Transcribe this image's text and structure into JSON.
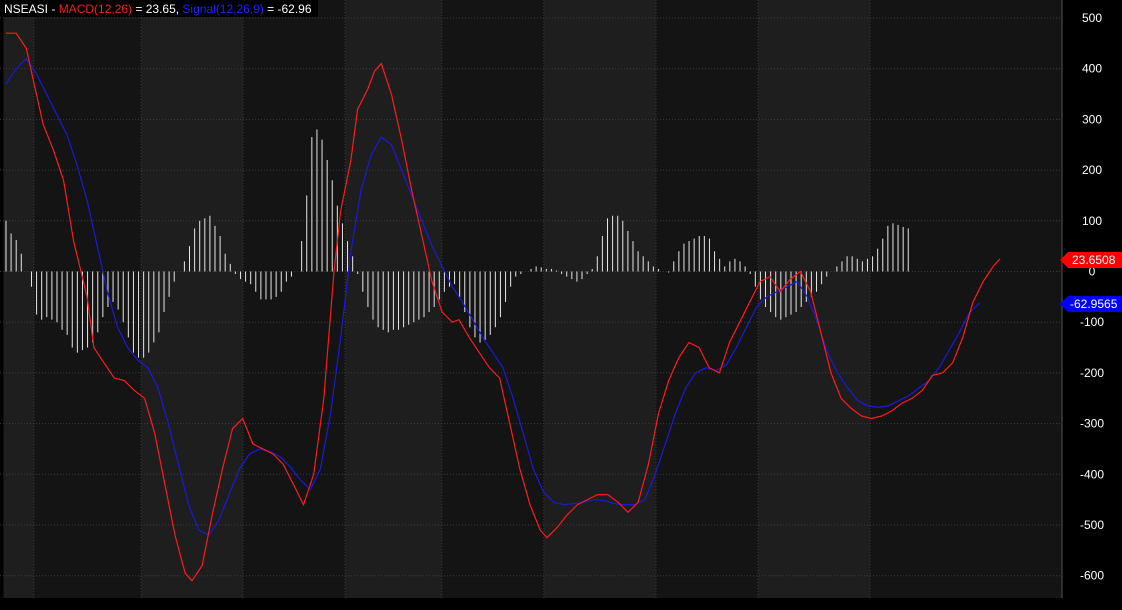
{
  "legend": {
    "symbol": "NSEASI",
    "separator": " - ",
    "macd_label": "MACD(12,26)",
    "macd_value_text": " = 23.65, ",
    "signal_label": "Signal(12,26,9)",
    "signal_value_text": " = -62.96"
  },
  "badges": {
    "macd": "23.6508",
    "signal": "-62.9565"
  },
  "colors": {
    "background": "#000000",
    "panel_dark": "#141414",
    "panel_light": "#1e1e1e",
    "grid": "#3a3a3a",
    "macd": "#ff1a1a",
    "signal": "#1a1adc",
    "histogram": "#e6e6e6",
    "axis_text": "#ffffff",
    "macd_badge": "#ff0000",
    "signal_badge": "#0000ff"
  },
  "chart_data": {
    "type": "line",
    "title": "",
    "xlabel": "",
    "ylabel": "",
    "ylim": [
      -630,
      530
    ],
    "y_ticks": [
      500,
      400,
      300,
      200,
      100,
      0,
      -100,
      -200,
      -300,
      -400,
      -500,
      -600
    ],
    "grid": true,
    "n_bars": 196,
    "bands": [
      {
        "from": 0,
        "to": 6,
        "shade": "light"
      },
      {
        "from": 6,
        "to": 27,
        "shade": "dark"
      },
      {
        "from": 27,
        "to": 47,
        "shade": "light"
      },
      {
        "from": 47,
        "to": 67,
        "shade": "dark"
      },
      {
        "from": 67,
        "to": 86,
        "shade": "light"
      },
      {
        "from": 86,
        "to": 106,
        "shade": "dark"
      },
      {
        "from": 106,
        "to": 128,
        "shade": "light"
      },
      {
        "from": 128,
        "to": 148,
        "shade": "dark"
      },
      {
        "from": 148,
        "to": 170,
        "shade": "light"
      },
      {
        "from": 170,
        "to": 196,
        "shade": "dark"
      }
    ],
    "series": [
      {
        "name": "MACD(12,26)",
        "color": "#ff1a1a",
        "points": [
          [
            0,
            470
          ],
          [
            3,
            470
          ],
          [
            6,
            440
          ],
          [
            9,
            350
          ],
          [
            11,
            290
          ],
          [
            14,
            240
          ],
          [
            17,
            180
          ],
          [
            20,
            60
          ],
          [
            24,
            -50
          ],
          [
            26,
            -150
          ],
          [
            29,
            -180
          ],
          [
            32,
            -210
          ],
          [
            35,
            -215
          ],
          [
            38,
            -235
          ],
          [
            41,
            -250
          ],
          [
            44,
            -320
          ],
          [
            47,
            -420
          ],
          [
            50,
            -520
          ],
          [
            53,
            -595
          ],
          [
            55,
            -610
          ],
          [
            58,
            -580
          ],
          [
            61,
            -480
          ],
          [
            64,
            -390
          ],
          [
            67,
            -310
          ],
          [
            70,
            -290
          ],
          [
            73,
            -340
          ],
          [
            76,
            -350
          ],
          [
            79,
            -360
          ],
          [
            82,
            -380
          ],
          [
            85,
            -420
          ],
          [
            88,
            -460
          ],
          [
            91,
            -400
          ],
          [
            94,
            -250
          ],
          [
            97,
            0
          ],
          [
            99,
            120
          ],
          [
            102,
            220
          ],
          [
            104,
            320
          ],
          [
            107,
            360
          ],
          [
            109,
            395
          ],
          [
            111,
            410
          ],
          [
            114,
            350
          ],
          [
            117,
            260
          ],
          [
            120,
            160
          ],
          [
            123,
            70
          ],
          [
            126,
            -20
          ],
          [
            129,
            -80
          ],
          [
            132,
            -100
          ],
          [
            134,
            -95
          ],
          [
            137,
            -130
          ],
          [
            140,
            -160
          ],
          [
            143,
            -190
          ],
          [
            146,
            -210
          ],
          [
            149,
            -300
          ],
          [
            152,
            -390
          ],
          [
            155,
            -460
          ],
          [
            158,
            -510
          ],
          [
            160,
            -525
          ],
          [
            163,
            -505
          ],
          [
            166,
            -480
          ],
          [
            169,
            -460
          ],
          [
            172,
            -450
          ],
          [
            175,
            -440
          ],
          [
            178,
            -440
          ],
          [
            181,
            -455
          ],
          [
            184,
            -475
          ],
          [
            187,
            -455
          ],
          [
            190,
            -380
          ],
          [
            193,
            -280
          ],
          [
            196,
            -215
          ],
          [
            199,
            -170
          ],
          [
            202,
            -140
          ],
          [
            205,
            -150
          ],
          [
            208,
            -190
          ],
          [
            211,
            -200
          ],
          [
            214,
            -140
          ],
          [
            217,
            -100
          ],
          [
            220,
            -60
          ],
          [
            223,
            -20
          ],
          [
            226,
            -10
          ],
          [
            229,
            -40
          ],
          [
            232,
            -15
          ],
          [
            235,
            0
          ],
          [
            238,
            -40
          ],
          [
            241,
            -120
          ],
          [
            244,
            -200
          ],
          [
            247,
            -250
          ],
          [
            250,
            -270
          ],
          [
            253,
            -285
          ],
          [
            256,
            -290
          ],
          [
            259,
            -285
          ],
          [
            262,
            -275
          ],
          [
            265,
            -260
          ],
          [
            268,
            -250
          ],
          [
            271,
            -235
          ],
          [
            274,
            -205
          ],
          [
            277,
            -200
          ],
          [
            280,
            -180
          ],
          [
            283,
            -130
          ],
          [
            286,
            -60
          ],
          [
            289,
            -20
          ],
          [
            292,
            10
          ],
          [
            294,
            25
          ]
        ]
      },
      {
        "name": "Signal(12,26,9)",
        "color": "#1a1adc",
        "points": [
          [
            0,
            370
          ],
          [
            3,
            400
          ],
          [
            6,
            420
          ],
          [
            9,
            390
          ],
          [
            12,
            350
          ],
          [
            15,
            310
          ],
          [
            18,
            270
          ],
          [
            21,
            210
          ],
          [
            24,
            140
          ],
          [
            27,
            50
          ],
          [
            30,
            -40
          ],
          [
            33,
            -110
          ],
          [
            36,
            -150
          ],
          [
            39,
            -175
          ],
          [
            42,
            -190
          ],
          [
            45,
            -230
          ],
          [
            48,
            -300
          ],
          [
            51,
            -380
          ],
          [
            54,
            -460
          ],
          [
            57,
            -510
          ],
          [
            60,
            -520
          ],
          [
            63,
            -490
          ],
          [
            66,
            -440
          ],
          [
            69,
            -390
          ],
          [
            72,
            -360
          ],
          [
            75,
            -350
          ],
          [
            78,
            -355
          ],
          [
            81,
            -365
          ],
          [
            84,
            -385
          ],
          [
            87,
            -410
          ],
          [
            90,
            -430
          ],
          [
            93,
            -390
          ],
          [
            96,
            -280
          ],
          [
            99,
            -130
          ],
          [
            102,
            40
          ],
          [
            105,
            160
          ],
          [
            108,
            230
          ],
          [
            111,
            265
          ],
          [
            114,
            250
          ],
          [
            117,
            200
          ],
          [
            120,
            150
          ],
          [
            123,
            100
          ],
          [
            126,
            50
          ],
          [
            129,
            10
          ],
          [
            132,
            -30
          ],
          [
            135,
            -60
          ],
          [
            138,
            -95
          ],
          [
            141,
            -130
          ],
          [
            144,
            -160
          ],
          [
            147,
            -190
          ],
          [
            150,
            -250
          ],
          [
            153,
            -320
          ],
          [
            156,
            -390
          ],
          [
            159,
            -435
          ],
          [
            162,
            -455
          ],
          [
            165,
            -460
          ],
          [
            168,
            -458
          ],
          [
            171,
            -455
          ],
          [
            174,
            -450
          ],
          [
            177,
            -452
          ],
          [
            180,
            -458
          ],
          [
            183,
            -460
          ],
          [
            186,
            -460
          ],
          [
            189,
            -450
          ],
          [
            192,
            -400
          ],
          [
            195,
            -340
          ],
          [
            198,
            -280
          ],
          [
            201,
            -230
          ],
          [
            204,
            -200
          ],
          [
            207,
            -190
          ],
          [
            210,
            -195
          ],
          [
            213,
            -185
          ],
          [
            216,
            -150
          ],
          [
            219,
            -110
          ],
          [
            222,
            -70
          ],
          [
            225,
            -50
          ],
          [
            228,
            -40
          ],
          [
            231,
            -30
          ],
          [
            234,
            -20
          ],
          [
            237,
            -50
          ],
          [
            240,
            -100
          ],
          [
            243,
            -160
          ],
          [
            246,
            -200
          ],
          [
            249,
            -230
          ],
          [
            252,
            -255
          ],
          [
            255,
            -265
          ],
          [
            258,
            -268
          ],
          [
            261,
            -265
          ],
          [
            264,
            -255
          ],
          [
            267,
            -245
          ],
          [
            270,
            -230
          ],
          [
            273,
            -215
          ],
          [
            276,
            -190
          ],
          [
            279,
            -155
          ],
          [
            282,
            -120
          ],
          [
            285,
            -80
          ],
          [
            288,
            -62
          ]
        ]
      },
      {
        "name": "Histogram",
        "color": "#e6e6e6",
        "values": [
          100,
          75,
          62,
          35,
          0,
          -30,
          -85,
          -95,
          -90,
          -95,
          -100,
          -115,
          -125,
          -150,
          -160,
          -155,
          -150,
          -140,
          -120,
          -90,
          -70,
          -60,
          -75,
          -100,
          -130,
          -160,
          -170,
          -170,
          -160,
          -140,
          -120,
          -80,
          -50,
          -20,
          0,
          20,
          50,
          85,
          100,
          105,
          110,
          90,
          70,
          35,
          15,
          -5,
          -15,
          -20,
          -25,
          -40,
          -55,
          -55,
          -55,
          -50,
          -40,
          -20,
          -10,
          0,
          60,
          150,
          265,
          280,
          260,
          220,
          180,
          130,
          95,
          60,
          30,
          -5,
          -40,
          -70,
          -95,
          -110,
          -115,
          -120,
          -115,
          -115,
          -110,
          -105,
          -100,
          -95,
          -90,
          -80,
          -70,
          -55,
          -40,
          -30,
          -25,
          -50,
          -80,
          -110,
          -130,
          -140,
          -135,
          -125,
          -110,
          -90,
          -60,
          -30,
          -10,
          -5,
          0,
          5,
          10,
          8,
          5,
          5,
          2,
          -5,
          -10,
          -15,
          -20,
          -15,
          -5,
          5,
          30,
          70,
          105,
          110,
          110,
          100,
          80,
          60,
          40,
          30,
          20,
          10,
          5,
          0,
          -2,
          20,
          40,
          55,
          60,
          65,
          70,
          70,
          65,
          40,
          25,
          10,
          20,
          25,
          20,
          10,
          -5,
          -30,
          -55,
          -70,
          -80,
          -90,
          -95,
          -90,
          -85,
          -80,
          -70,
          -60,
          -50,
          -40,
          -25,
          -10,
          0,
          10,
          20,
          30,
          30,
          25,
          20,
          25,
          30,
          45,
          65,
          90,
          95,
          92,
          88,
          85
        ]
      }
    ]
  }
}
